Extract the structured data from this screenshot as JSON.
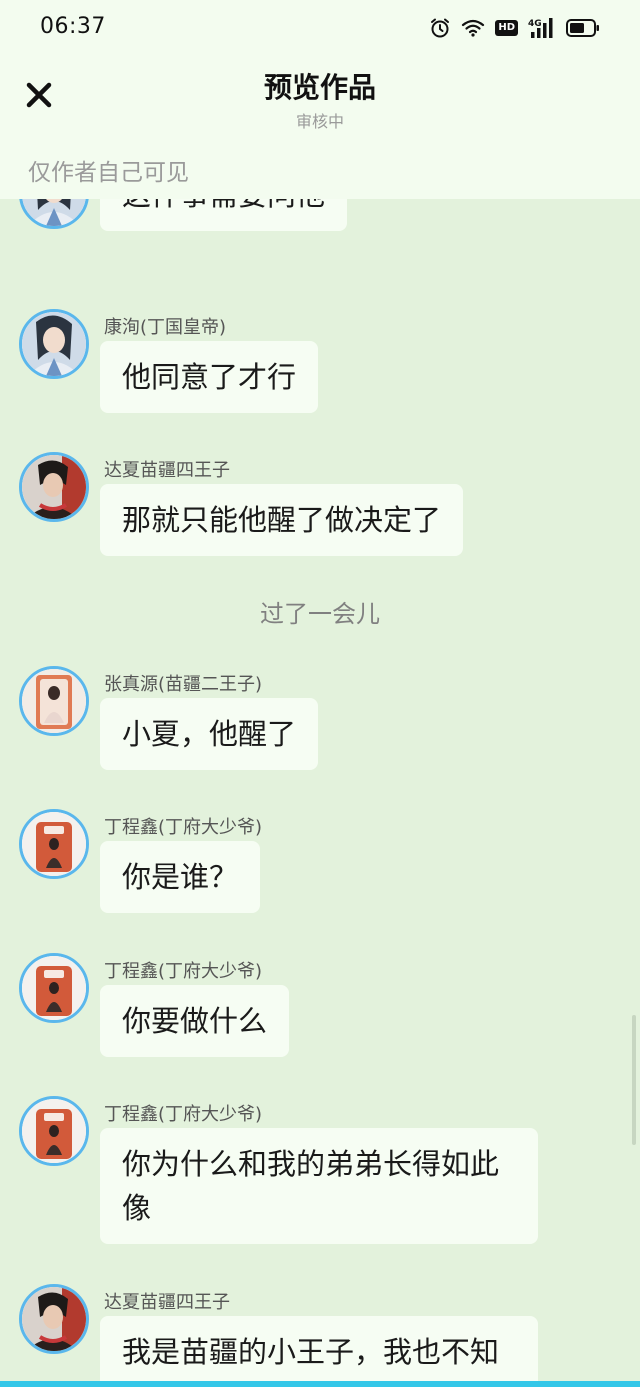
{
  "status_bar": {
    "time": "06:37",
    "icons": [
      "alarm-icon",
      "wifi-icon",
      "hd-badge",
      "signal-4g-icon",
      "battery-icon"
    ],
    "hd_label": "HD",
    "network_label": "4G"
  },
  "header": {
    "close_icon": "close-icon",
    "title": "预览作品",
    "subtitle": "审核中"
  },
  "visibility_note": "仅作者自己可见",
  "messages": [
    {
      "sender": "",
      "avatar": "avatar-kangxun",
      "text": "这件事需要问他"
    },
    {
      "sender": "康洵(丁国皇帝)",
      "avatar": "avatar-kangxun",
      "text": "他同意了才行"
    },
    {
      "sender": "达夏苗疆四王子",
      "avatar": "avatar-daxia",
      "text": "那就只能他醒了做决定了"
    },
    {
      "sender": "张真源(苗疆二王子)",
      "avatar": "avatar-zhang",
      "text": "小夏，他醒了"
    },
    {
      "sender": "丁程鑫(丁府大少爷)",
      "avatar": "avatar-ding",
      "text": "你是谁？"
    },
    {
      "sender": "丁程鑫(丁府大少爷)",
      "avatar": "avatar-ding",
      "text": "你要做什么"
    },
    {
      "sender": "丁程鑫(丁府大少爷)",
      "avatar": "avatar-ding",
      "text": "你为什么和我的弟弟长得如此像"
    },
    {
      "sender": "达夏苗疆四王子",
      "avatar": "avatar-daxia",
      "text": "我是苗疆的小王子，我也不知"
    }
  ],
  "divider": "过了一会儿",
  "colors": {
    "background": "#e3f2dc",
    "header_background": "#f3fcef",
    "bubble": "#f6fdf3",
    "avatar_ring": "#5ab7ec",
    "accent_line": "#34c7e8"
  }
}
